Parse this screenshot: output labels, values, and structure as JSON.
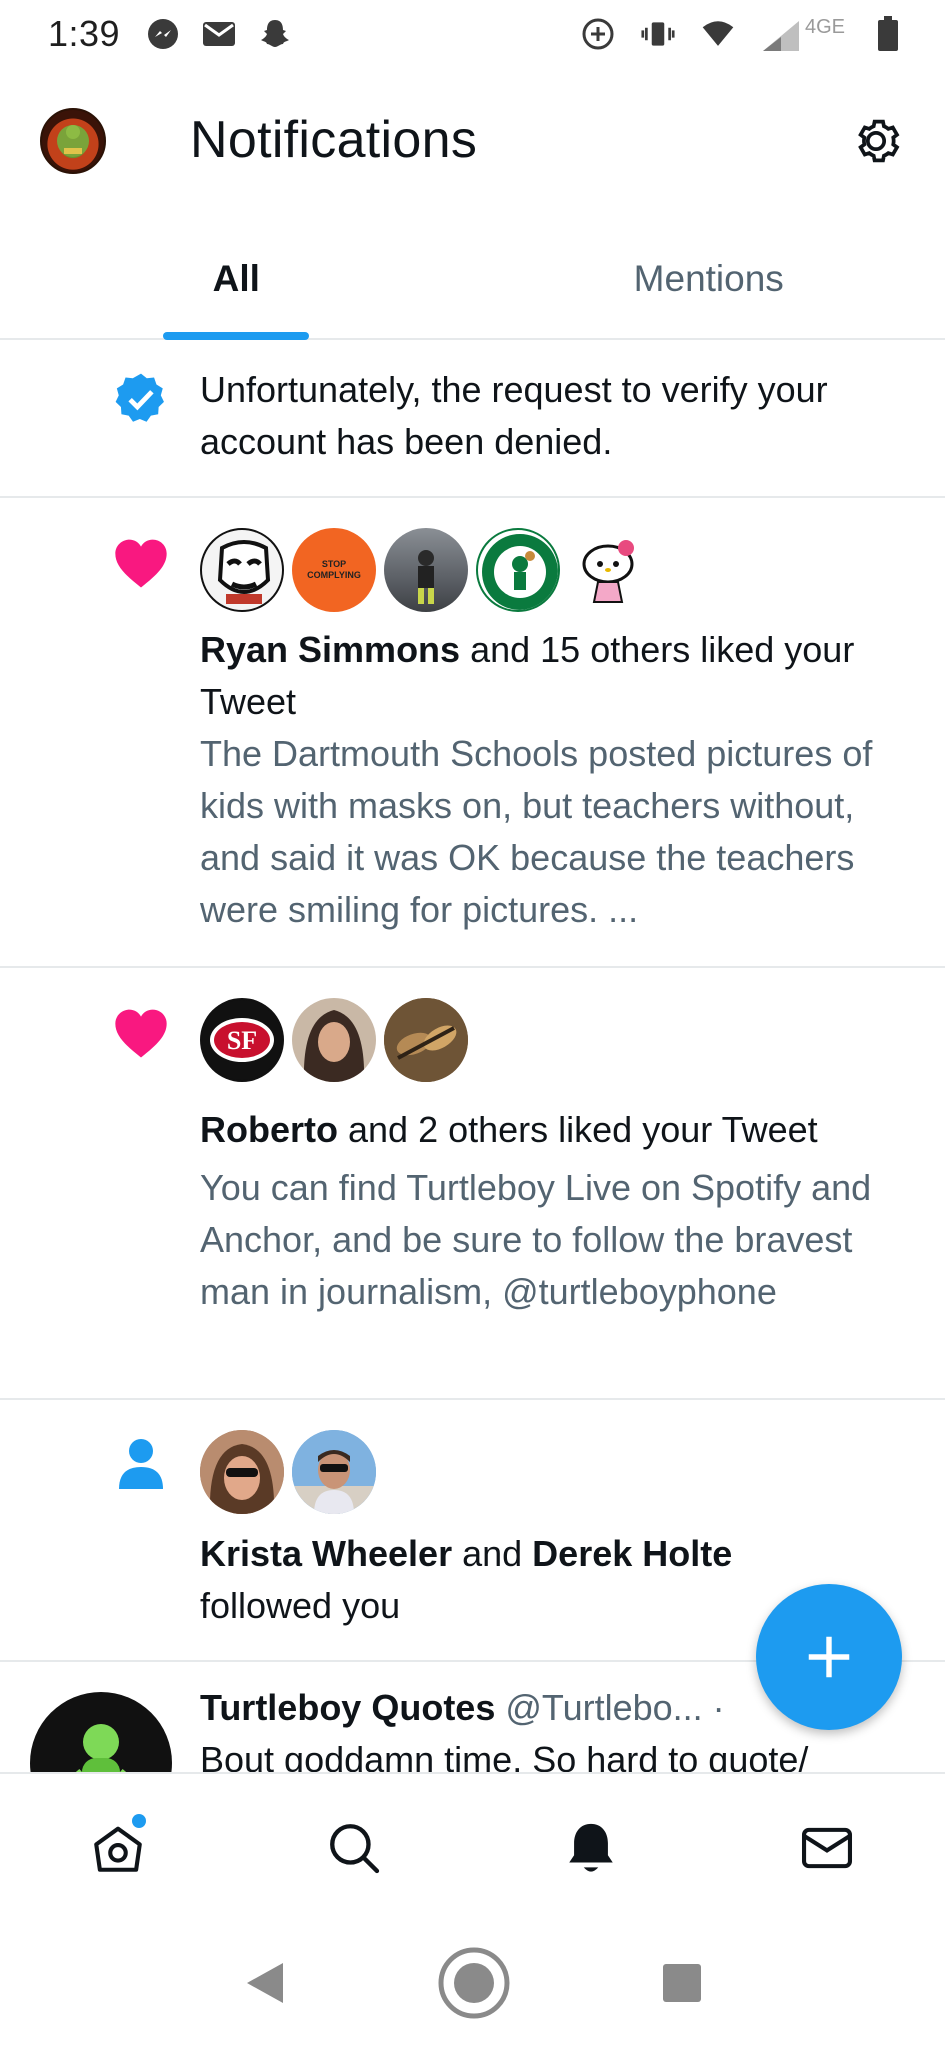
{
  "status_bar": {
    "time": "1:39",
    "network": "4GE",
    "icons_left": [
      "messenger-icon",
      "gmail-icon",
      "snapchat-icon"
    ],
    "icons_right": [
      "data-saver-icon",
      "vibrate-icon",
      "wifi-icon",
      "signal-icon",
      "battery-icon"
    ]
  },
  "header": {
    "title": "Notifications"
  },
  "tabs": [
    {
      "label": "All",
      "active": true
    },
    {
      "label": "Mentions",
      "active": false
    }
  ],
  "notifications": [
    {
      "type": "verification",
      "text": "Unfortunately, the request to verify your account has been denied."
    },
    {
      "type": "like",
      "avatars": [
        "obey-face",
        "stop-complying",
        "gym-person",
        "celtics-logo",
        "hello-kitty"
      ],
      "avatar_text": "STOP COMPLYING",
      "actor": "Ryan Simmons",
      "action": " and 15 others liked your Tweet",
      "tweet": "The Dartmouth Schools posted pictures of kids with masks on, but teachers without, and said it was OK because the teachers were smiling for pictures. ..."
    },
    {
      "type": "like",
      "avatars": [
        "49ers-logo",
        "woman-portrait",
        "sandals-photo"
      ],
      "actor": "Roberto",
      "action": " and 2 others liked your Tweet",
      "tweet": "You can find Turtleboy Live on Spotify and Anchor, and be sure to follow the bravest man in journalism, @turtleboyphone"
    },
    {
      "type": "follow",
      "avatars": [
        "woman-sunglasses",
        "man-sunglasses"
      ],
      "actor1": "Krista Wheeler",
      "joiner": " and ",
      "actor2": "Derek Holte",
      "action": "followed you"
    },
    {
      "type": "tweet",
      "name": "Turtleboy Quotes",
      "handle": "@Turtlebo...",
      "separator": " · ",
      "text": "Bout goddamn time. So hard to quote/"
    }
  ],
  "colors": {
    "accent": "#1d9bf0",
    "like": "#f91880",
    "text": "#0f1419",
    "secondary": "#536471"
  },
  "bottom_nav": [
    "home-icon",
    "search-icon",
    "notifications-icon",
    "messages-icon"
  ],
  "system_nav": [
    "back-icon",
    "home-icon",
    "recents-icon"
  ]
}
